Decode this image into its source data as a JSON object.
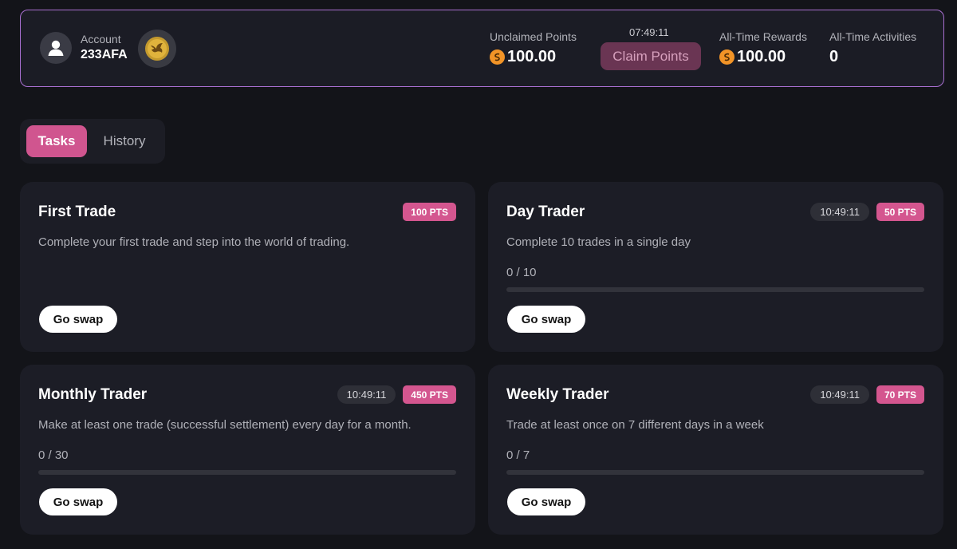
{
  "account": {
    "label": "Account",
    "id": "233AFA",
    "avatar_icon": "user-icon",
    "badge_icon": "bird-emblem-icon"
  },
  "stats": {
    "unclaimed": {
      "label": "Unclaimed Points",
      "value": "100.00",
      "icon": "points-coin-icon"
    },
    "claim": {
      "countdown": "07:49:11",
      "button_label": "Claim Points"
    },
    "rewards": {
      "label": "All-Time Rewards",
      "value": "100.00",
      "icon": "points-coin-icon"
    },
    "activities": {
      "label": "All-Time Activities",
      "value": "0"
    }
  },
  "tabs": [
    {
      "label": "Tasks",
      "active": true
    },
    {
      "label": "History",
      "active": false
    }
  ],
  "tasks": [
    {
      "title": "First Trade",
      "description": "Complete your first trade and step into the world of trading.",
      "timer": null,
      "points": "100 PTS",
      "progress": null,
      "button_label": "Go swap"
    },
    {
      "title": "Day Trader",
      "description": "Complete 10 trades in a single day",
      "timer": "10:49:11",
      "points": "50 PTS",
      "progress": {
        "text": "0 / 10",
        "fraction": 0
      },
      "button_label": "Go swap"
    },
    {
      "title": "Monthly Trader",
      "description": "Make at least one trade (successful settlement) every day for a month.",
      "timer": "10:49:11",
      "points": "450 PTS",
      "progress": {
        "text": "0 / 30",
        "fraction": 0
      },
      "button_label": "Go swap"
    },
    {
      "title": "Weekly Trader",
      "description": "Trade at least once on 7 different days in a week",
      "timer": "10:49:11",
      "points": "70 PTS",
      "progress": {
        "text": "0 / 7",
        "fraction": 0
      },
      "button_label": "Go swap"
    }
  ],
  "colors": {
    "accent": "#d4568f",
    "claim_button_bg": "#6a3553",
    "coin": "#f29427",
    "card_border": "#a86fd0"
  }
}
